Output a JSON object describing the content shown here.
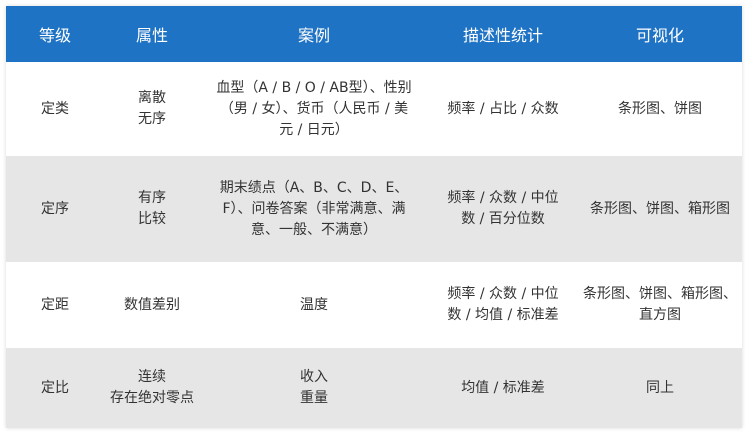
{
  "headers": {
    "level": "等级",
    "attribute": "属性",
    "example": "案例",
    "stats": "描述性统计",
    "visual": "可视化"
  },
  "rows": [
    {
      "level": "定类",
      "attribute": [
        "离散",
        "无序"
      ],
      "example": [
        "血型（A / B / O / AB型）、性别",
        "（男 / 女）、货币（人民币 / 美",
        "元 / 日元）"
      ],
      "stats": [
        "频率 / 占比 / 众数"
      ],
      "visual": [
        "条形图、饼图"
      ]
    },
    {
      "level": "定序",
      "attribute": [
        "有序",
        "比较"
      ],
      "example": [
        "期末绩点（A、B、C、D、E、",
        "F）、问卷答案（非常满意、满",
        "意、一般、不满意）"
      ],
      "stats": [
        "频率 / 众数 / 中位",
        "数 / 百分位数"
      ],
      "visual": [
        "条形图、饼图、箱形图"
      ]
    },
    {
      "level": "定距",
      "attribute": [
        "数值差别"
      ],
      "example": [
        "温度"
      ],
      "stats": [
        "频率 / 众数 / 中位",
        "数 / 均值 / 标准差"
      ],
      "visual": [
        "条形图、饼图、箱形图、",
        "直方图"
      ]
    },
    {
      "level": "定比",
      "attribute": [
        "连续",
        "存在绝对零点"
      ],
      "example": [
        "收入",
        "重量"
      ],
      "stats": [
        "均值 / 标准差"
      ],
      "visual": [
        "同上"
      ]
    }
  ]
}
